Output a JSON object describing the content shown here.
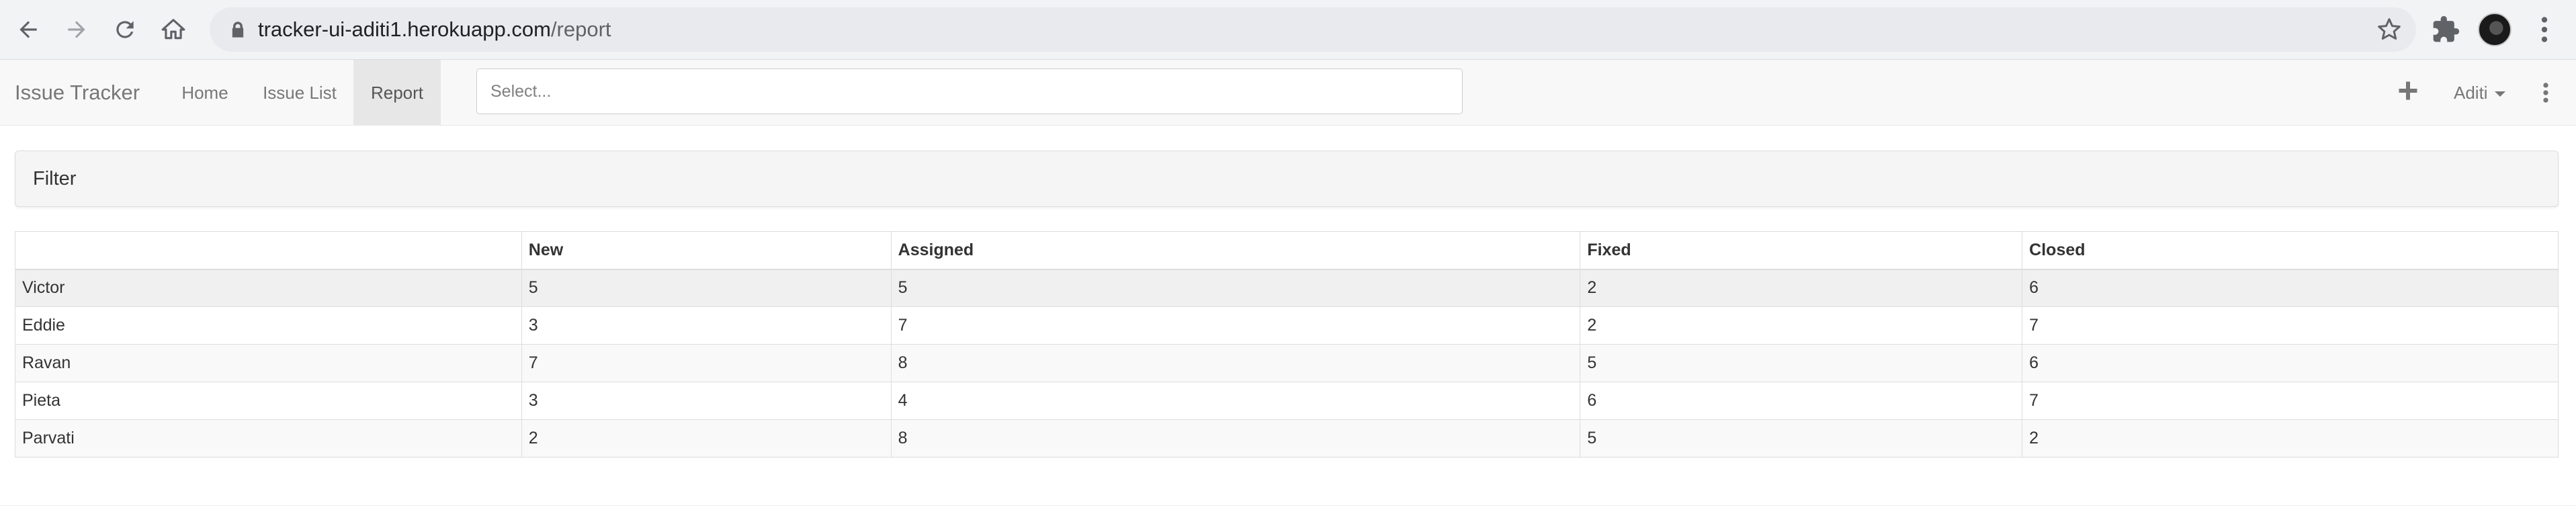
{
  "browser": {
    "url_host": "tracker-ui-aditi1.herokuapp.com",
    "url_path": "/report",
    "icons": [
      "back-icon",
      "forward-icon",
      "reload-icon",
      "home-icon",
      "lock-icon",
      "star-icon",
      "extensions-icon",
      "profile-avatar",
      "chrome-menu-icon"
    ]
  },
  "navbar": {
    "brand": "Issue Tracker",
    "links": [
      {
        "label": "Home",
        "active": false
      },
      {
        "label": "Issue List",
        "active": false
      },
      {
        "label": "Report",
        "active": true
      }
    ],
    "search": {
      "placeholder": "Select..."
    },
    "add_icon": "plus-icon",
    "user": "Aditi",
    "menu_icon": "kebab-icon"
  },
  "filter": {
    "title": "Filter"
  },
  "report": {
    "columns": [
      "",
      "New",
      "Assigned",
      "Fixed",
      "Closed"
    ],
    "rows": [
      {
        "name": "Victor",
        "values": [
          "5",
          "5",
          "2",
          "6"
        ]
      },
      {
        "name": "Eddie",
        "values": [
          "3",
          "7",
          "2",
          "7"
        ]
      },
      {
        "name": "Ravan",
        "values": [
          "7",
          "8",
          "5",
          "6"
        ]
      },
      {
        "name": "Pieta",
        "values": [
          "3",
          "4",
          "6",
          "7"
        ]
      },
      {
        "name": "Parvati",
        "values": [
          "2",
          "8",
          "5",
          "2"
        ]
      }
    ]
  },
  "colors": {
    "chrome_bg": "#f1f3f4",
    "omnibox_bg": "#e8eaed",
    "navbar_bg": "#f8f8f8",
    "active_link_bg": "#e7e7e7",
    "panel_bg": "#f5f5f5",
    "border": "#dddddd"
  }
}
